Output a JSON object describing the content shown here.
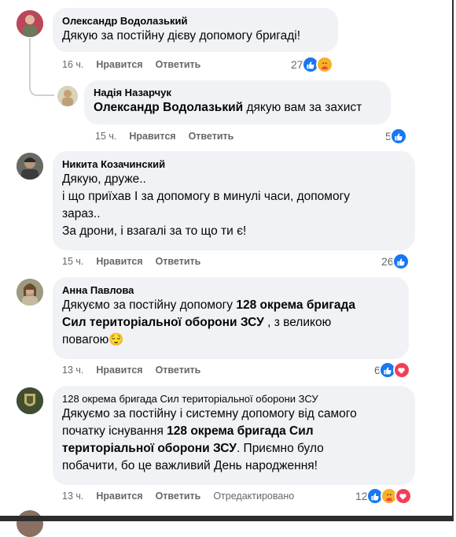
{
  "comments": [
    {
      "author": "Олександр Водолазький",
      "text_lines": [
        "Дякую за постійну дієву допомогу бригаді!"
      ],
      "time": "16 ч.",
      "like_label": "Нравится",
      "reply_label": "Ответить",
      "reaction_count": "27",
      "reactions": [
        "like",
        "care"
      ]
    },
    {
      "author": "Надія Назарчук",
      "mention": "Олександр Водолазький",
      "text_rest": " дякую вам за захист",
      "time": "15 ч.",
      "like_label": "Нравится",
      "reply_label": "Ответить",
      "reaction_count": "5",
      "reactions": [
        "like"
      ]
    },
    {
      "author": "Никита Козачинский",
      "text_lines": [
        "Дякую, друже..",
        "і що приїхав І за допомогу в минулі часи, допомогу",
        "зараз..",
        "За дрони, і взагалі за то що ти є!"
      ],
      "time": "15 ч.",
      "like_label": "Нравится",
      "reply_label": "Ответить",
      "reaction_count": "26",
      "reactions": [
        "like"
      ]
    },
    {
      "author": "Анна Павлова",
      "line1_pre": "Дякуємо за постійну допомогу ",
      "line1_bold": "128 окрема бригада",
      "line2_bold": "Сил територіальної оборони ЗСУ",
      "line2_rest": " , з великою",
      "line3": "повагою",
      "emoji": "😌",
      "time": "13 ч.",
      "like_label": "Нравится",
      "reply_label": "Ответить",
      "reaction_count": "6",
      "reactions": [
        "like",
        "heart"
      ]
    },
    {
      "author": "128 окрема бригада Сил територіальної оборони ЗСУ",
      "line1": "Дякуємо за постійну і системну допомогу від самого",
      "line2_pre": "початку існування ",
      "line2_bold": "128 окрема бригада Сил",
      "line3_bold": "територіальної оборони ЗСУ",
      "line3_rest": ". Приємно було",
      "line4": "побачити, бо це важливий День народження!",
      "time": "13 ч.",
      "like_label": "Нравится",
      "reply_label": "Ответить",
      "edited_label": "Отредактировано",
      "reaction_count": "12",
      "reactions": [
        "like",
        "care",
        "heart"
      ]
    }
  ],
  "colors": {
    "bubble": "#f0f2f5",
    "meta": "#65676b",
    "like": "#1877f2",
    "heart": "#f33e58",
    "care": "#f7b125"
  }
}
